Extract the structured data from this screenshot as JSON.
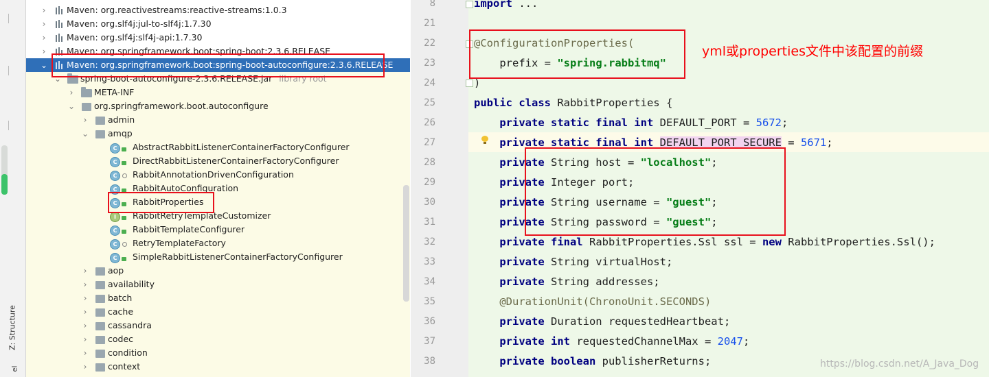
{
  "sidebar": {
    "structure_label": "Z: Structure",
    "bottom_label": "el"
  },
  "tree": {
    "rows": [
      {
        "label": "Maven: org.reactivestreams:reactive-streams:1.0.3"
      },
      {
        "label": "Maven: org.slf4j:jul-to-slf4j:1.7.30"
      },
      {
        "label": "Maven: org.slf4j:slf4j-api:1.7.30"
      },
      {
        "label": "Maven: org.springframework.boot:spring-boot:2.3.6.RELEASE"
      },
      {
        "label": "Maven: org.springframework.boot:spring-boot-autoconfigure:2.3.6.RELEASE"
      },
      {
        "label": "spring-boot-autoconfigure-2.3.6.RELEASE.jar",
        "hint": "library root"
      },
      {
        "label": "META-INF"
      },
      {
        "label": "org.springframework.boot.autoconfigure"
      },
      {
        "label": "admin"
      },
      {
        "label": "amqp"
      },
      {
        "label": "AbstractRabbitListenerContainerFactoryConfigurer"
      },
      {
        "label": "DirectRabbitListenerContainerFactoryConfigurer"
      },
      {
        "label": "RabbitAnnotationDrivenConfiguration"
      },
      {
        "label": "RabbitAutoConfiguration"
      },
      {
        "label": "RabbitProperties"
      },
      {
        "label": "RabbitRetryTemplateCustomizer"
      },
      {
        "label": "RabbitTemplateConfigurer"
      },
      {
        "label": "RetryTemplateFactory"
      },
      {
        "label": "SimpleRabbitListenerContainerFactoryConfigurer"
      },
      {
        "label": "aop"
      },
      {
        "label": "availability"
      },
      {
        "label": "batch"
      },
      {
        "label": "cache"
      },
      {
        "label": "cassandra"
      },
      {
        "label": "codec"
      },
      {
        "label": "condition"
      },
      {
        "label": "context"
      }
    ]
  },
  "editor": {
    "line_numbers": [
      "8",
      "21",
      "22",
      "23",
      "24",
      "25",
      "26",
      "27",
      "28",
      "29",
      "30",
      "31",
      "32",
      "33",
      "34",
      "35",
      "36",
      "37",
      "38"
    ],
    "code": {
      "l8_kw": "import",
      "l8_rest": " ...",
      "l22": "@ConfigurationProperties(",
      "l23_a": "    prefix = ",
      "l23_str": "\"spring.rabbitmq\"",
      "l24": ")",
      "l25_kw": "public class",
      "l25_rest": " RabbitProperties {",
      "l26_kw": "private static final int",
      "l26_rest": " DEFAULT_PORT = ",
      "l26_num": "5672",
      "l27_kw": "private static final int",
      "l27_hl": "DEFAULT_PORT_SECURE",
      "l27_rest": " = ",
      "l27_num": "5671",
      "l28_kw": "private",
      "l28_rest": " String host = ",
      "l28_str": "\"localhost\"",
      "l29_kw": "private",
      "l29_rest": " Integer port;",
      "l30_kw": "private",
      "l30_rest": " String username = ",
      "l30_str": "\"guest\"",
      "l31_kw": "private",
      "l31_rest": " String password = ",
      "l31_str": "\"guest\"",
      "l32_kw": "private final",
      "l32_rest": " RabbitProperties.Ssl ssl = ",
      "l32_kw2": "new",
      "l32_rest2": " RabbitProperties.Ssl();",
      "l33_kw": "private",
      "l33_rest": " String virtualHost;",
      "l34_kw": "private",
      "l34_rest": " String addresses;",
      "l35": "@DurationUnit(ChronoUnit.SECONDS)",
      "l36_kw": "private",
      "l36_rest": " Duration requestedHeartbeat;",
      "l37_kw": "private int",
      "l37_rest": " requestedChannelMax = ",
      "l37_num": "2047",
      "l38_kw": "private boolean",
      "l38_rest": " publisherReturns;",
      "semi": ";"
    }
  },
  "annotation": {
    "note": "yml或properties文件中该配置的前缀",
    "color": "#ff0000"
  },
  "watermark": "https://blog.csdn.net/A_Java_Dog"
}
